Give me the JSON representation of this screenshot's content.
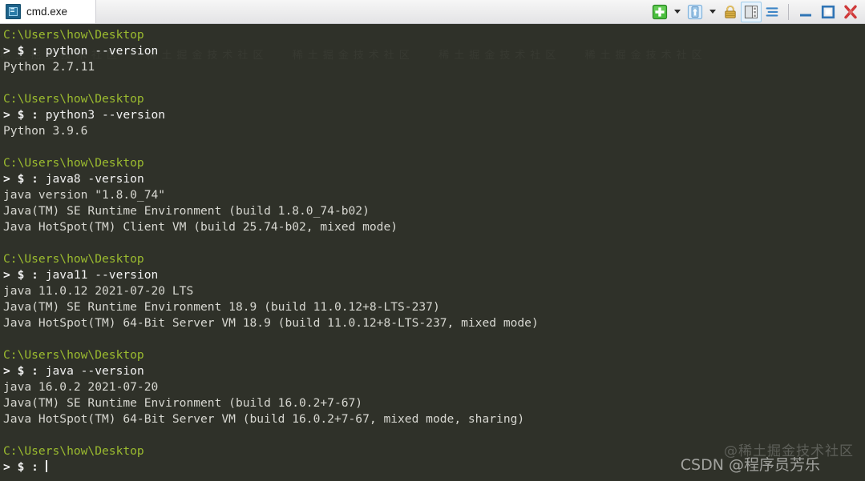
{
  "window": {
    "title": "cmd.exe",
    "tab_icon": "console-icon"
  },
  "toolbar": {
    "new_console_label": "+",
    "new_console_caret_label": "▼",
    "active_console_label": "↑",
    "active_console_caret_label": "▼",
    "lock_label": "🔒",
    "split_view_label": "split",
    "menu_label": "☰",
    "minimize_label": "—",
    "maximize_label": "□",
    "close_label": "✖",
    "icons": {
      "new_console": "plus-green-icon",
      "new_console_dropdown": "chevron-down-icon",
      "active_console": "up-arrow-icon",
      "active_console_dropdown": "chevron-down-icon",
      "lock": "lock-icon",
      "split_view": "split-panes-icon",
      "menu": "hamburger-menu-icon",
      "minimize": "minimize-icon",
      "maximize": "maximize-icon",
      "close": "close-icon"
    }
  },
  "colors": {
    "terminal_background": "#2f3129",
    "path_green": "#9bbb2f",
    "prompt_white": "#f2f2f2",
    "output_grey": "#d7d7d1",
    "close_red": "#cf3a3a",
    "accent_blue": "#1d6189"
  },
  "terminal": {
    "prompt_path": "C:\\Users\\how\\Desktop",
    "prompt_sigil": "> $ : ",
    "blocks": [
      {
        "path": "C:\\Users\\how\\Desktop",
        "command": "python --version",
        "output": [
          "Python 2.7.11"
        ]
      },
      {
        "path": "C:\\Users\\how\\Desktop",
        "command": "python3 --version",
        "output": [
          "Python 3.9.6"
        ]
      },
      {
        "path": "C:\\Users\\how\\Desktop",
        "command": "java8 -version",
        "output": [
          "java version \"1.8.0_74\"",
          "Java(TM) SE Runtime Environment (build 1.8.0_74-b02)",
          "Java HotSpot(TM) Client VM (build 25.74-b02, mixed mode)"
        ]
      },
      {
        "path": "C:\\Users\\how\\Desktop",
        "command": "java11 --version",
        "output": [
          "java 11.0.12 2021-07-20 LTS",
          "Java(TM) SE Runtime Environment 18.9 (build 11.0.12+8-LTS-237)",
          "Java HotSpot(TM) 64-Bit Server VM 18.9 (build 11.0.12+8-LTS-237, mixed mode)"
        ]
      },
      {
        "path": "C:\\Users\\how\\Desktop",
        "command": "java --version",
        "output": [
          "java 16.0.2 2021-07-20",
          "Java(TM) SE Runtime Environment (build 16.0.2+7-67)",
          "Java HotSpot(TM) 64-Bit Server VM (build 16.0.2+7-67, mixed mode, sharing)"
        ]
      }
    ],
    "final_prompt": {
      "path": "C:\\Users\\how\\Desktop",
      "command": ""
    }
  },
  "watermarks": {
    "juejin": "@稀土掘金技术社区",
    "csdn": "CSDN @程序员芳乐",
    "background_tile": "稀土掘金技术社区   稀土掘金技术社区   稀土掘金技术社区   稀土掘金技术社区   稀土掘金技术社区"
  }
}
